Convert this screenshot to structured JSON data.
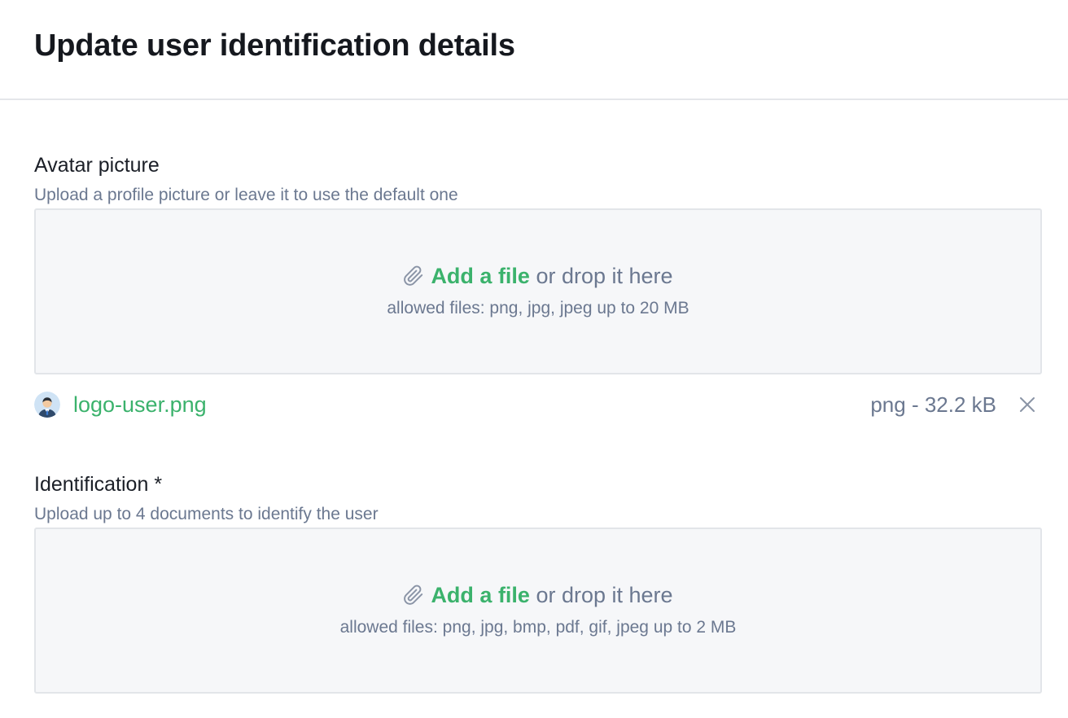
{
  "page": {
    "title": "Update user identification details"
  },
  "avatar": {
    "label": "Avatar picture",
    "hint": "Upload a profile picture or leave it to use the default one",
    "dropzone": {
      "link_text": "Add a file",
      "rest_text": " or drop it here",
      "allowed": "allowed files: png, jpg, jpeg up to 20 MB",
      "icon": "paperclip-icon"
    },
    "file": {
      "name": "logo-user.png",
      "meta": "png - 32.2 kB",
      "icon": "user-avatar-icon",
      "remove_icon": "close-icon"
    }
  },
  "identification": {
    "label": "Identification *",
    "hint": "Upload up to 4 documents to identify the user",
    "dropzone": {
      "link_text": "Add a file",
      "rest_text": " or drop it here",
      "allowed": "allowed files: png, jpg, bmp, pdf, gif, jpeg up to 2 MB",
      "icon": "paperclip-icon"
    }
  },
  "colors": {
    "accent": "#3bb26c",
    "muted_text": "#6b7890",
    "dropzone_bg": "#f6f7f9",
    "border": "#e2e5e9"
  }
}
